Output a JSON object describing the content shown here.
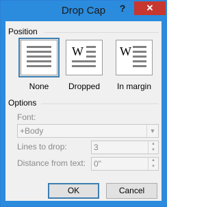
{
  "window": {
    "title": "Drop Cap"
  },
  "titlebar": {
    "help": "?",
    "close": "✕"
  },
  "position": {
    "label": "Position",
    "options": [
      {
        "label": "None",
        "glyph": ""
      },
      {
        "label": "Dropped",
        "glyph": "W"
      },
      {
        "label": "In margin",
        "glyph": "W"
      }
    ]
  },
  "options": {
    "label": "Options",
    "font": {
      "label": "Font:",
      "value": "+Body"
    },
    "lines_to_drop": {
      "label": "Lines to drop:",
      "value": "3"
    },
    "distance_from_text": {
      "label": "Distance from text:",
      "value": "0\""
    }
  },
  "buttons": {
    "ok": "OK",
    "cancel": "Cancel"
  }
}
